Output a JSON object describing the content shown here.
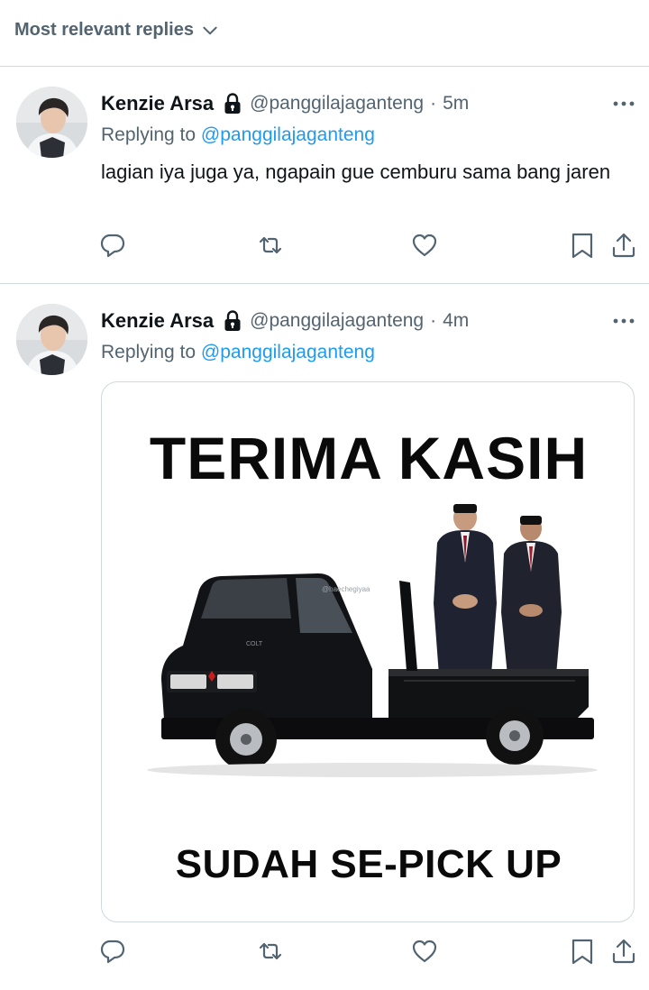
{
  "sort": {
    "label": "Most relevant replies",
    "icon": "chevron-down-icon"
  },
  "tweets": [
    {
      "name": "Kenzie Arsa",
      "handle": "@panggilajaganteng",
      "separator": "·",
      "time": "5m",
      "replying_prefix": "Replying to",
      "replying_to": "@panggilajaganteng",
      "text": "lagian iya juga ya, ngapain gue cemburu sama bang jaren"
    },
    {
      "name": "Kenzie Arsa",
      "handle": "@panggilajaganteng",
      "separator": "·",
      "time": "4m",
      "replying_prefix": "Replying to",
      "replying_to": "@panggilajaganteng",
      "media": {
        "top_text": "TERIMA KASIH",
        "bottom_text": "SUDAH SE-PICK UP",
        "truck_badge": "COLT",
        "watermark": "@haechegiyaa"
      }
    }
  ],
  "colors": {
    "link": "#1d9bf0",
    "muted": "#536471",
    "text": "#0f1419",
    "divider": "#cfd9de"
  }
}
